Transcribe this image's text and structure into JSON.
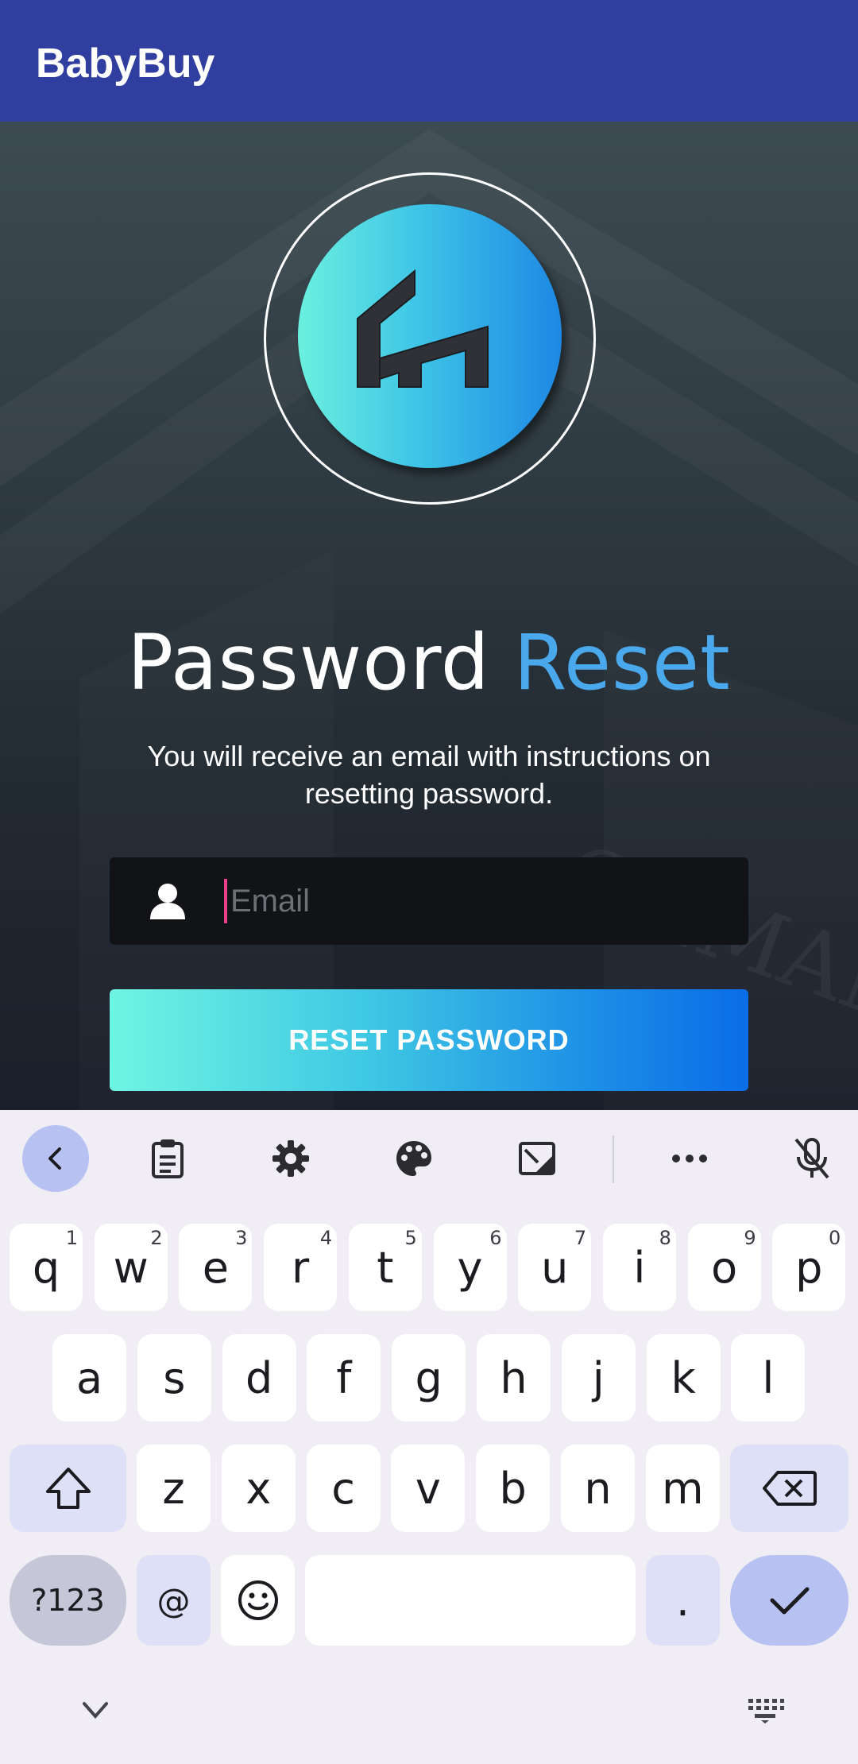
{
  "app": {
    "title": "BabyBuy"
  },
  "reset_page": {
    "title_part1": "Password",
    "title_part2": "Reset",
    "subtitle": "You will receive an email with instructions on resetting password.",
    "email_placeholder": "Email",
    "email_value": "",
    "button_label": "RESET PASSWORD"
  },
  "colors": {
    "appbar": "#303f9f",
    "accent_blue": "#4aa8ec",
    "button_gradient_start": "#6ff5e2",
    "button_gradient_end": "#0a6de8",
    "caret": "#e83e8c"
  },
  "keyboard": {
    "toolbar": [
      "back-icon",
      "clipboard-icon",
      "settings-icon",
      "palette-icon",
      "resize-icon",
      "more-icon",
      "mic-off-icon"
    ],
    "row1": [
      {
        "key": "q",
        "hint": "1"
      },
      {
        "key": "w",
        "hint": "2"
      },
      {
        "key": "e",
        "hint": "3"
      },
      {
        "key": "r",
        "hint": "4"
      },
      {
        "key": "t",
        "hint": "5"
      },
      {
        "key": "y",
        "hint": "6"
      },
      {
        "key": "u",
        "hint": "7"
      },
      {
        "key": "i",
        "hint": "8"
      },
      {
        "key": "o",
        "hint": "9"
      },
      {
        "key": "p",
        "hint": "0"
      }
    ],
    "row2": [
      "a",
      "s",
      "d",
      "f",
      "g",
      "h",
      "j",
      "k",
      "l"
    ],
    "row3": [
      "z",
      "x",
      "c",
      "v",
      "b",
      "n",
      "m"
    ],
    "row4": {
      "symbols": "?123",
      "at": "@",
      "period": "."
    }
  }
}
